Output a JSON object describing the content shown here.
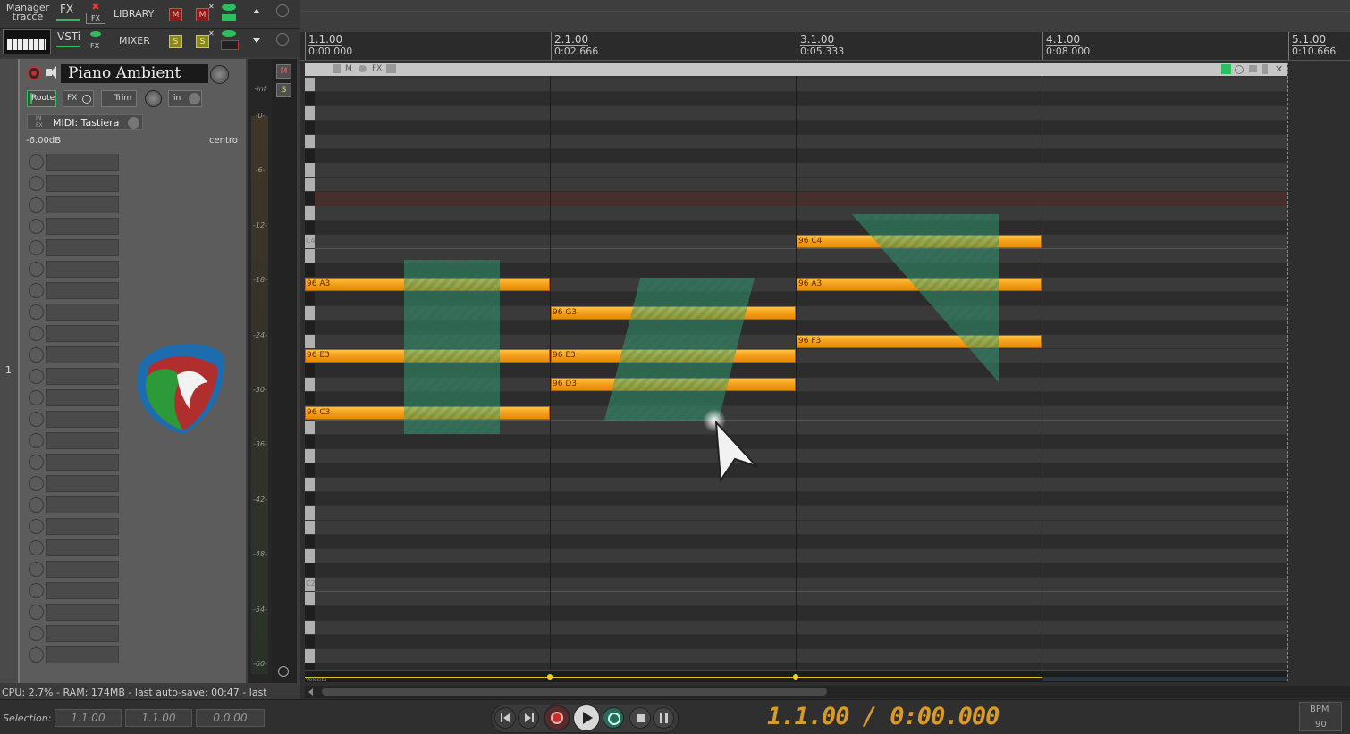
{
  "toolbar": {
    "manager": "Manager\ntracce",
    "fx": "FX",
    "fx_sub": "FX",
    "library": "LIBRARY",
    "vsti": "VSTi",
    "vsti_sub": "FX",
    "mixer": "MIXER",
    "m_label": "M",
    "s_label": "S"
  },
  "track": {
    "number": "1",
    "name": "Piano Ambient",
    "route": "Route",
    "fx": "FX",
    "trim": "Trim",
    "in": "in",
    "in_fx": "IN\nFX",
    "midi_input": "MIDI: Tastiera",
    "volume": "-6.00dB",
    "pan": "centro",
    "meter_m": "M",
    "meter_s": "S",
    "db_scale": [
      "-inf",
      "-0-",
      "-6-",
      "-12-",
      "-18-",
      "-24-",
      "-30-",
      "-36-",
      "-42-",
      "-48-",
      "-54-",
      "-60-"
    ]
  },
  "ruler": [
    {
      "bar": "1.1.00",
      "time": "0:00.000"
    },
    {
      "bar": "2.1.00",
      "time": "0:02.666"
    },
    {
      "bar": "3.1.00",
      "time": "0:05.333"
    },
    {
      "bar": "4.1.00",
      "time": "0:08.000"
    },
    {
      "bar": "5.1.00",
      "time": "0:10.666"
    }
  ],
  "item_header": {
    "m": "M",
    "fx": "FX"
  },
  "key_labels": {
    "c4": "C4",
    "c2": "C2"
  },
  "notes": [
    {
      "label": "96 A3"
    },
    {
      "label": "96 E3"
    },
    {
      "label": "96 C3"
    },
    {
      "label": "96 G3"
    },
    {
      "label": "96 E3"
    },
    {
      "label": "96 D3"
    },
    {
      "label": "96 C4"
    },
    {
      "label": "96 A3"
    },
    {
      "label": "96 F3"
    }
  ],
  "automation_label": "Velocità",
  "status": {
    "text": "CPU: 2.7% - RAM: 174MB -  last auto-save: 00:47 -  last"
  },
  "selection": {
    "label": "Selection:",
    "start": "1.1.00",
    "end": "1.1.00",
    "length": "0.0.00"
  },
  "transport": {
    "position": "1.1.00 / 0:00.000",
    "bpm_label": "BPM",
    "bpm": "90"
  },
  "colors": {
    "note": "#f5a11a",
    "accent": "#2dbf5f",
    "record": "#c43030"
  }
}
